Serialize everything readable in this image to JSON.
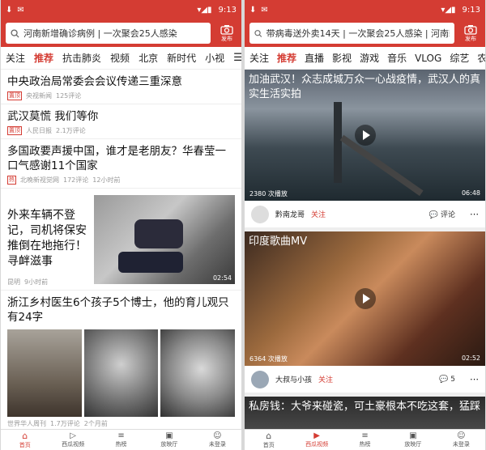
{
  "status": {
    "time": "9:13"
  },
  "left": {
    "search_text": "河南新增确诊病例 | 一次聚会25人感染",
    "publish_label": "发布",
    "tabs": [
      "关注",
      "推荐",
      "抗击肺炎",
      "视频",
      "北京",
      "新时代",
      "小视"
    ],
    "news": [
      {
        "title": "中央政治局常委会会议传递三重深意",
        "tag": "置顶",
        "source": "央视新闻",
        "comments": "125评论"
      },
      {
        "title": "武汉莫慌 我们等你",
        "tag": "置顶",
        "source": "人民日报",
        "comments": "2.1万评论"
      },
      {
        "title": "多国政要声援中国，谁才是老朋友？华春莹一口气感谢11个国家",
        "tag": "热",
        "source": "北晚新视觉网",
        "comments": "172评论",
        "time": "12小时前"
      },
      {
        "title": "外来车辆不登记，司机将保安推倒在地拖行！寻衅滋事",
        "source": "昆明",
        "time": "9小时前",
        "duration": "02:54"
      },
      {
        "title": "浙江乡村医生6个孩子5个博士，他的育儿观只有24字",
        "source": "世界华人周刊",
        "comments": "1.7万评论",
        "time": "2个月前"
      }
    ]
  },
  "right": {
    "search_text": "带病毒送外卖14天 | 一次聚会25人感染 | 河南新增...",
    "publish_label": "发布",
    "tabs": [
      "关注",
      "推荐",
      "直播",
      "影视",
      "游戏",
      "音乐",
      "VLOG",
      "综艺",
      "农"
    ],
    "videos": [
      {
        "title": "加油武汉！众志成城万众一心战疫情，武汉人的真实生活实拍",
        "plays": "2380 次播放",
        "duration": "06:48",
        "author": "黔南龙哥",
        "follow": "关注",
        "comment": "评论"
      },
      {
        "title": "印度歌曲MV",
        "plays": "6364 次播放",
        "duration": "02:52",
        "author": "大叔与小孩",
        "follow": "关注",
        "comment": "5"
      },
      {
        "title": "私房钱：大爷来碰瓷，可土豪根本不吃这套，猛踩"
      }
    ]
  },
  "nav": {
    "left": [
      "首页",
      "西瓜视频",
      "热榜",
      "放映厅",
      "未登录"
    ],
    "right": [
      "首页",
      "西瓜视频",
      "热榜",
      "放映厅",
      "未登录"
    ]
  },
  "colors": {
    "brand": "#d43c33"
  }
}
